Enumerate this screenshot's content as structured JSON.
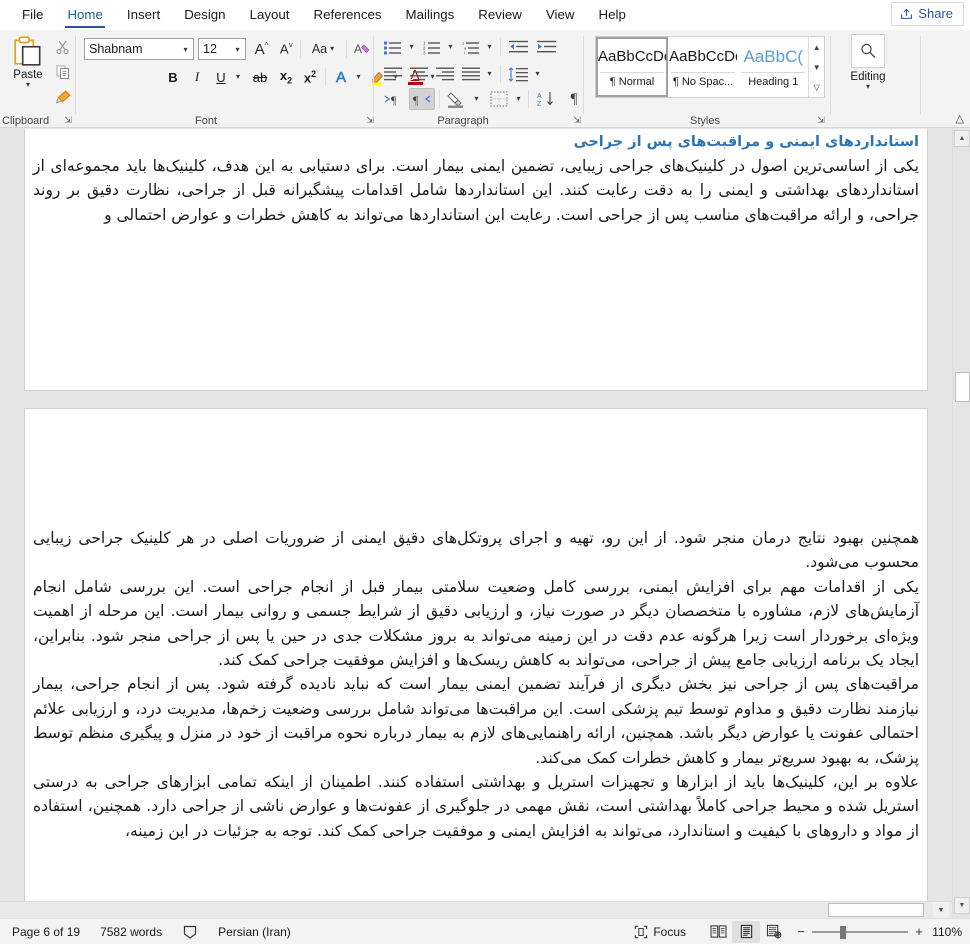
{
  "app": {
    "tabs": [
      "File",
      "Home",
      "Insert",
      "Design",
      "Layout",
      "References",
      "Mailings",
      "Review",
      "View",
      "Help"
    ],
    "active_tab": "Home",
    "share_label": "Share",
    "ribbon_collapse_icon": "chevron-up-icon"
  },
  "ribbon": {
    "groups": [
      {
        "name": "Clipboard",
        "label": "Clipboard"
      },
      {
        "name": "Font",
        "label": "Font"
      },
      {
        "name": "Paragraph",
        "label": "Paragraph"
      },
      {
        "name": "Styles",
        "label": "Styles"
      },
      {
        "name": "Editing",
        "label": "Editing"
      }
    ],
    "clipboard": {
      "paste_label": "Paste",
      "cut_icon": "scissors-icon",
      "copy_icon": "copy-icon",
      "format_painter_icon": "format-painter-icon"
    },
    "font": {
      "font_name": "Shabnam",
      "font_size": "12",
      "grow_font": "A^",
      "shrink_font": "Av",
      "change_case": "Aa",
      "clear_formatting_icon": "clear-formatting-icon",
      "bold": "B",
      "italic": "I",
      "underline": "U",
      "strikethrough": "ab",
      "subscript": "x₂",
      "superscript": "x²",
      "text_effects_icon": "text-effects-icon",
      "highlight_icon": "text-highlight-icon",
      "font_color_icon": "font-color-icon",
      "highlight_color": "#ffff00",
      "font_color": "#c00000"
    },
    "paragraph": {
      "bullets_icon": "bullets-icon",
      "numbering_icon": "numbering-icon",
      "multilevel_icon": "multilevel-list-icon",
      "decrease_indent_icon": "decrease-indent-icon",
      "increase_indent_icon": "increase-indent-icon",
      "align_left_icon": "align-left-icon",
      "align_center_icon": "align-center-icon",
      "align_right_icon": "align-right-icon",
      "justify_icon": "justify-icon",
      "line_spacing_icon": "line-spacing-icon",
      "ltr_icon": "left-to-right-icon",
      "rtl_icon": "right-to-left-icon",
      "rtl_active": true,
      "shading_icon": "shading-icon",
      "borders_icon": "borders-icon",
      "sort_icon": "sort-icon",
      "show_marks_icon": "pilcrow-icon"
    },
    "styles": {
      "items": [
        {
          "preview": "AaBbCcDc",
          "name": "¶ Normal",
          "selected": true,
          "heading": false
        },
        {
          "preview": "AaBbCcDc",
          "name": "¶ No Spac...",
          "selected": false,
          "heading": false
        },
        {
          "preview": "AaBbC(",
          "name": "Heading 1",
          "selected": false,
          "heading": true
        }
      ],
      "scroll_up_icon": "chevron-up-icon",
      "scroll_down_icon": "chevron-down-icon",
      "more_icon": "more-styles-icon"
    },
    "editing": {
      "label": "Editing",
      "icon": "magnifier-icon"
    }
  },
  "document": {
    "page1": {
      "heading": "استانداردهای ایمنی و مراقبت‌های پس از جراحی",
      "paragraph": "یکی از اساسی‌ترین اصول در کلینیک‌های جراحی زیبایی، تضمین ایمنی بیمار است. برای دستیابی به این هدف، کلینیک‌ها باید مجموعه‌ای از استانداردهای بهداشتی و ایمنی را به دقت رعایت کنند. این استانداردها شامل اقدامات پیشگیرانه قبل از جراحی، نظارت دقیق بر روند جراحی، و ارائه مراقبت‌های مناسب پس از جراحی است. رعایت این استانداردها می‌تواند به کاهش خطرات و عوارض احتمالی و"
    },
    "page2": {
      "paragraphs": [
        "همچنین بهبود نتایج درمان منجر شود. از این رو، تهیه و اجرای پروتکل‌های دقیق ایمنی از ضروریات اصلی در هر کلینیک جراحی زیبایی محسوب می‌شود.",
        "یکی از اقدامات مهم برای افزایش ایمنی، بررسی کامل وضعیت سلامتی بیمار قبل از انجام جراحی است. این بررسی شامل انجام آزمایش‌های لازم، مشاوره با متخصصان دیگر در صورت نیاز، و ارزیابی دقیق از شرایط جسمی و روانی بیمار است. این مرحله از اهمیت ویژه‌ای برخوردار است زیرا هرگونه عدم دقت در این زمینه می‌تواند به بروز مشکلات جدی در حین یا پس از جراحی منجر شود. بنابراین، ایجاد یک برنامه ارزیابی جامع پیش از جراحی، می‌تواند به کاهش ریسک‌ها و افزایش موفقیت جراحی کمک کند.",
        "مراقبت‌های پس از جراحی نیز بخش دیگری از فرآیند تضمین ایمنی بیمار است که نباید نادیده گرفته شود. پس از انجام جراحی، بیمار نیازمند نظارت دقیق و مداوم توسط تیم پزشکی است. این مراقبت‌ها می‌تواند شامل بررسی وضعیت زخم‌ها، مدیریت درد، و ارزیابی علائم احتمالی عفونت یا عوارض دیگر باشد. همچنین، ارائه راهنمایی‌های لازم به بیمار درباره نحوه مراقبت از خود در منزل و پیگیری منظم توسط پزشک، به بهبود سریع‌تر بیمار و کاهش خطرات کمک می‌کند.",
        "علاوه بر این، کلینیک‌ها باید از ابزارها و تجهیزات استریل و بهداشتی استفاده کنند. اطمینان از اینکه تمامی ابزارهای جراحی به درستی استریل شده و محیط جراحی کاملاً بهداشتی است، نقش مهمی در جلوگیری از عفونت‌ها و عوارض ناشی از جراحی دارد. همچنین، استفاده از مواد و داروهای با کیفیت و استاندارد، می‌تواند به افزایش ایمنی و موفقیت جراحی کمک کند. توجه به جزئیات در این زمینه،"
      ]
    }
  },
  "statusbar": {
    "page_info": "Page 6 of 19",
    "word_count": "7582 words",
    "proofing_icon": "proofing-errors-icon",
    "language": "Persian (Iran)",
    "focus_label": "Focus",
    "focus_icon": "focus-mode-icon",
    "read_mode_icon": "read-mode-icon",
    "print_layout_icon": "print-layout-icon",
    "web_layout_icon": "web-layout-icon",
    "active_view": "print-layout",
    "zoom_out": "−",
    "zoom_in": "+",
    "zoom_level": "110%"
  }
}
